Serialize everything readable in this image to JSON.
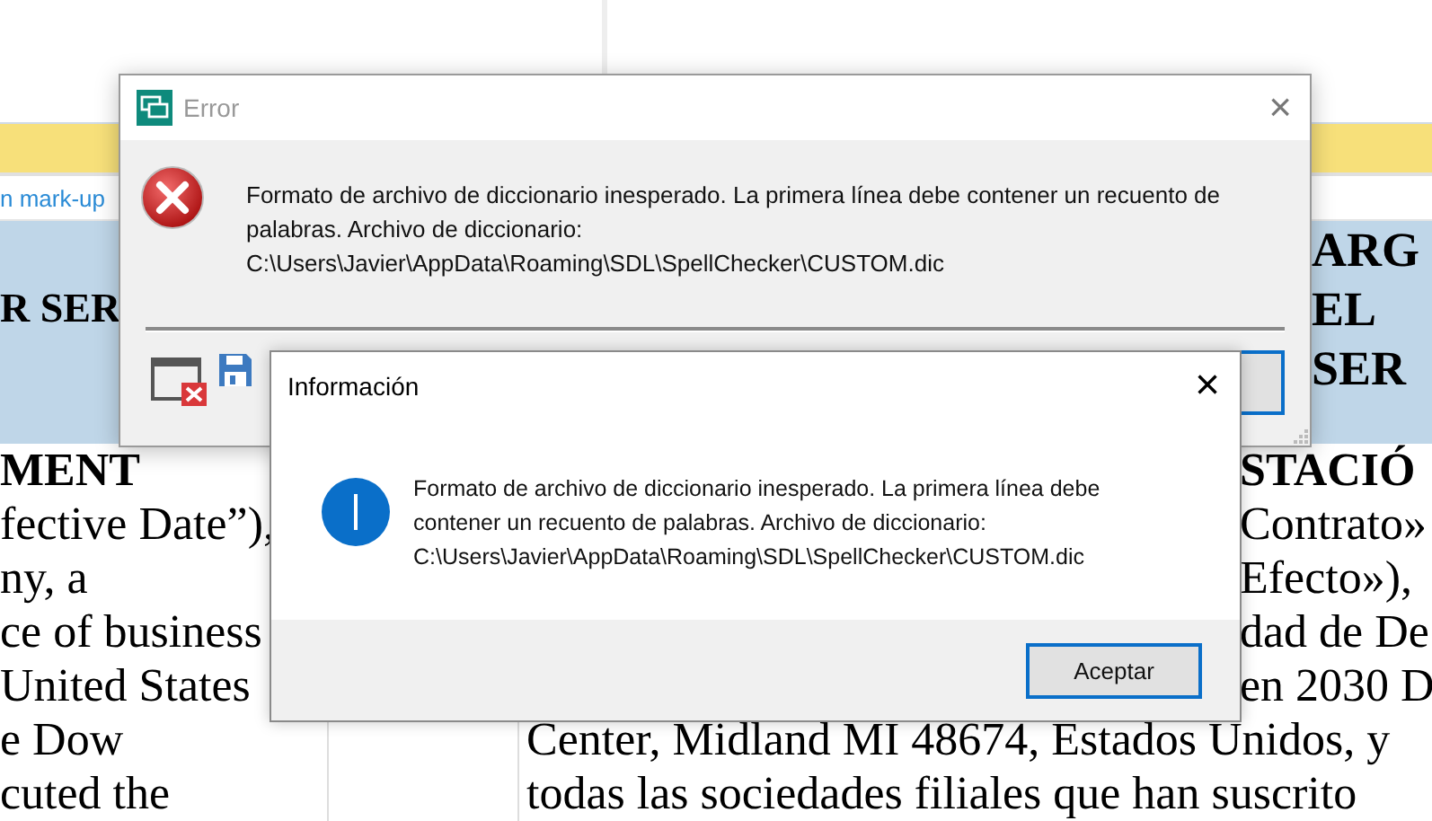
{
  "document": {
    "toolbar_link": "n mark-up",
    "header_left": "R SER",
    "header_right": [
      "ARG",
      "EL",
      "SER"
    ],
    "left_lines": [
      {
        "text": "MENT",
        "bold": true
      },
      {
        "text": "fective Date”),",
        "bold": false
      },
      {
        "text": "ny, a",
        "bold": false
      },
      {
        "text": "ce of business",
        "bold": false
      },
      {
        "text": "United States",
        "bold": false
      },
      {
        "text": "e Dow",
        "bold": false
      },
      {
        "text": "cuted the",
        "bold": false
      }
    ],
    "right_lines": [
      {
        "text": "STACIÓ",
        "bold": true,
        "start_hidden": true
      },
      {
        "text": "Contrato»",
        "bold": false,
        "start_hidden": true
      },
      {
        "text": "Efecto»),",
        "bold": false,
        "start_hidden": true
      },
      {
        "text": "dad de De",
        "bold": false,
        "start_hidden": true
      },
      {
        "text": "en 2030 D",
        "bold": false,
        "start_hidden": true
      },
      {
        "text": "Center, Midland MI 48674, Estados Unidos, y",
        "bold": false,
        "start_hidden": false
      },
      {
        "text": "todas las sociedades filiales que han suscrito",
        "bold": false,
        "start_hidden": false
      }
    ]
  },
  "error_dialog": {
    "title": "Error",
    "close": "×",
    "message_lines": [
      "Formato de archivo de diccionario inesperado. La primera línea debe contener un recuento de",
      "palabras. Archivo de diccionario:",
      "C:\\Users\\Javier\\AppData\\Roaming\\SDL\\SpellChecker\\CUSTOM.dic"
    ]
  },
  "info_dialog": {
    "title": "Información",
    "close": "×",
    "message_lines": [
      "Formato de archivo de diccionario inesperado. La primera línea debe",
      "contener un recuento de palabras. Archivo de diccionario:",
      "C:\\Users\\Javier\\AppData\\Roaming\\SDL\\SpellChecker\\CUSTOM.dic"
    ],
    "button": "Aceptar"
  }
}
